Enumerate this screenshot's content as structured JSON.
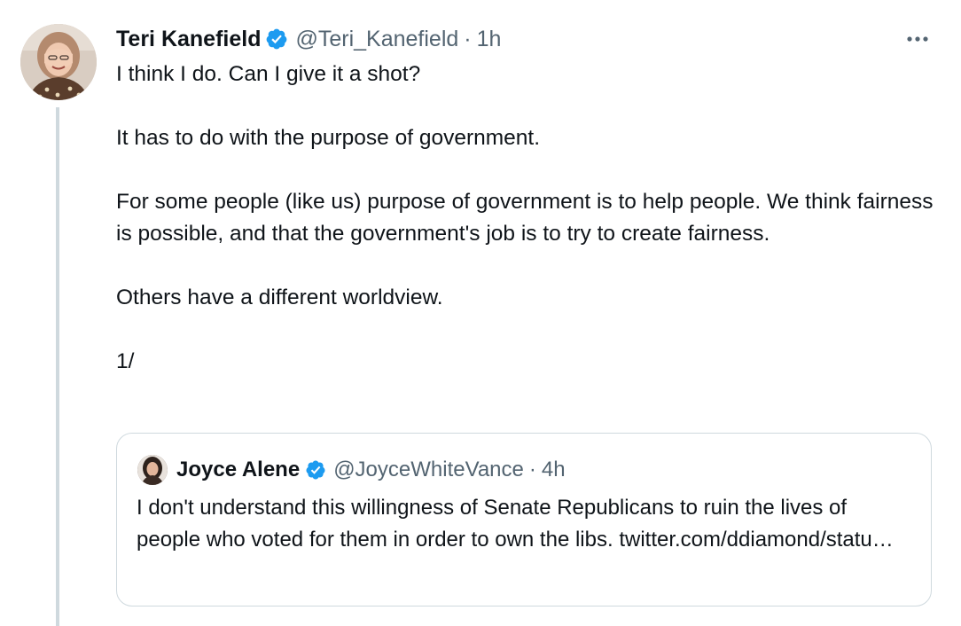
{
  "tweet": {
    "author_name": "Teri Kanefield",
    "handle": "@Teri_Kanefield",
    "separator": "·",
    "time": "1h",
    "paragraphs": [
      "I think I do. Can I give it a shot?",
      "It has to do with the purpose of government.",
      "For some people (like us) purpose of government is to help people. We think fairness is possible, and that the government's job is to try to create fairness.",
      "Others have a different worldview.",
      "1/"
    ]
  },
  "quoted_tweet": {
    "author_name": "Joyce Alene",
    "handle": "@JoyceWhiteVance",
    "separator": "·",
    "time": "4h",
    "text": "I don't understand this willingness of Senate Republicans to ruin the lives of people who voted for them in order to own the libs. twitter.com/ddiamond/statu…"
  },
  "icons": {
    "verified": "verified-badge-icon",
    "more": "more-options-icon"
  },
  "colors": {
    "text": "#0f1419",
    "secondary": "#536471",
    "verified": "#1d9bf0",
    "border": "#cfd9de"
  }
}
